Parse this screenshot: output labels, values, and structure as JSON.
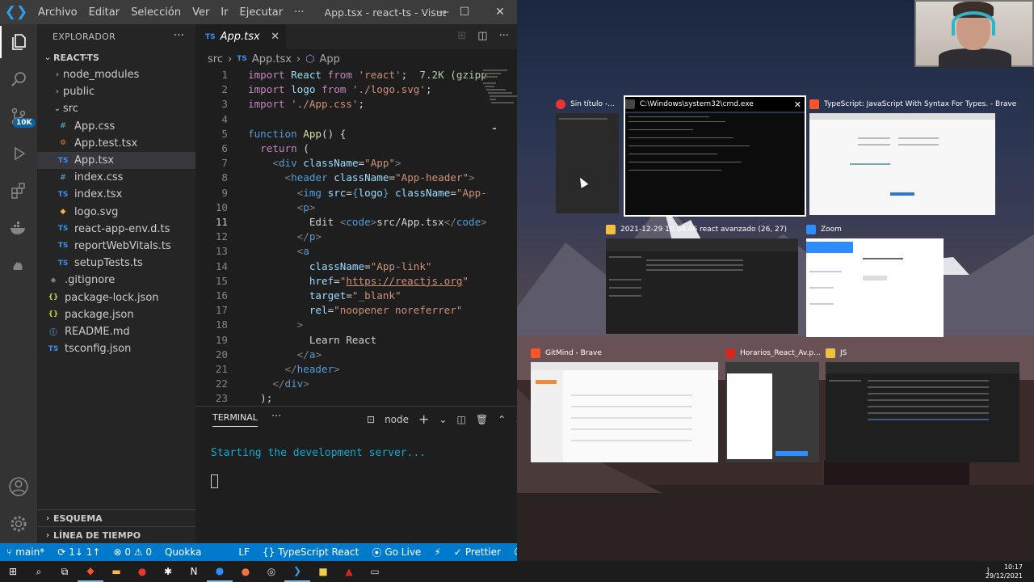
{
  "titlebar": {
    "menu": [
      "Archivo",
      "Editar",
      "Selección",
      "Ver",
      "Ir",
      "Ejecutar",
      "···"
    ],
    "title": "App.tsx - react-ts - Visual S..."
  },
  "activity": {
    "badge": "10K"
  },
  "sidebar": {
    "title": "EXPLORADOR",
    "root": "REACT-TS",
    "tree": [
      {
        "label": "node_modules",
        "kind": "folder",
        "icon": "chevron-right"
      },
      {
        "label": "public",
        "kind": "folder",
        "icon": "chevron-right"
      },
      {
        "label": "src",
        "kind": "folder-open",
        "icon": "chevron-down"
      },
      {
        "label": "App.css",
        "kind": "file",
        "icon": "#",
        "cls": "css"
      },
      {
        "label": "App.test.tsx",
        "kind": "file",
        "icon": "⚙",
        "cls": "test"
      },
      {
        "label": "App.tsx",
        "kind": "file",
        "icon": "TS",
        "cls": "ts",
        "selected": true
      },
      {
        "label": "index.css",
        "kind": "file",
        "icon": "#",
        "cls": "css"
      },
      {
        "label": "index.tsx",
        "kind": "file",
        "icon": "TS",
        "cls": "ts"
      },
      {
        "label": "logo.svg",
        "kind": "file",
        "icon": "◆",
        "cls": "svg"
      },
      {
        "label": "react-app-env.d.ts",
        "kind": "file",
        "icon": "TS",
        "cls": "ts"
      },
      {
        "label": "reportWebVitals.ts",
        "kind": "file",
        "icon": "TS",
        "cls": "ts"
      },
      {
        "label": "setupTests.ts",
        "kind": "file",
        "icon": "TS",
        "cls": "ts"
      },
      {
        "label": ".gitignore",
        "kind": "rootfile",
        "icon": "◆",
        "cls": "gray"
      },
      {
        "label": "package-lock.json",
        "kind": "rootfile",
        "icon": "{}",
        "cls": "json"
      },
      {
        "label": "package.json",
        "kind": "rootfile",
        "icon": "{}",
        "cls": "json"
      },
      {
        "label": "README.md",
        "kind": "rootfile",
        "icon": "ⓘ",
        "cls": "md"
      },
      {
        "label": "tsconfig.json",
        "kind": "rootfile",
        "icon": "TS",
        "cls": "ts"
      }
    ],
    "outline": "ESQUEMA",
    "timeline": "LÍNEA DE TIEMPO"
  },
  "tab": {
    "icon": "TS",
    "label": "App.tsx"
  },
  "breadcrumb": [
    "src",
    "›",
    "TS",
    "App.tsx",
    "›",
    "App"
  ],
  "code": [
    {
      "n": "1",
      "html": "<span class='k'>import</span> <span class='a'>React</span> <span class='k'>from</span> <span class='s'>'react'</span>;  <span class='g'>7.2K (gzipp</span>"
    },
    {
      "n": "2",
      "html": "<span class='k'>import</span> <span class='a'>logo</span> <span class='k'>from</span> <span class='s'>'./logo.svg'</span>;"
    },
    {
      "n": "3",
      "html": "<span class='k'>import</span> <span class='s'>'./App.css'</span>;"
    },
    {
      "n": "4",
      "html": ""
    },
    {
      "n": "5",
      "html": "<span class='kb'>function</span> <span class='f'>App</span>() {"
    },
    {
      "n": "6",
      "html": "  <span class='k'>return</span> ("
    },
    {
      "n": "7",
      "html": "    <span class='p'>&lt;</span><span class='tag'>div</span> <span class='a'>className</span>=<span class='s'>\"App\"</span><span class='p'>&gt;</span>"
    },
    {
      "n": "8",
      "html": "      <span class='p'>&lt;</span><span class='tag'>header</span> <span class='a'>className</span>=<span class='s'>\"App-header\"</span><span class='p'>&gt;</span>"
    },
    {
      "n": "9",
      "html": "        <span class='p'>&lt;</span><span class='tag'>img</span> <span class='a'>src</span>=<span class='kb'>{</span><span class='a'>logo</span><span class='kb'>}</span> <span class='a'>className</span>=<span class='s'>\"App-</span>"
    },
    {
      "n": "10",
      "html": "        <span class='p'>&lt;</span><span class='tag'>p</span><span class='p'>&gt;</span>"
    },
    {
      "n": "11",
      "html": "          Edit <span class='p'>&lt;</span><span class='tag'>code</span><span class='p'>&gt;</span>src/App.tsx<span class='p'>&lt;/</span><span class='tag'>code</span><span class='p'>&gt;</span>",
      "cur": true
    },
    {
      "n": "12",
      "html": "        <span class='p'>&lt;/</span><span class='tag'>p</span><span class='p'>&gt;</span>"
    },
    {
      "n": "13",
      "html": "        <span class='p'>&lt;</span><span class='tag'>a</span>"
    },
    {
      "n": "14",
      "html": "          <span class='a'>className</span>=<span class='s'>\"App-link\"</span>"
    },
    {
      "n": "15",
      "html": "          <span class='a'>href</span>=<span class='s'>\"<u>https://reactjs.org</u>\"</span>"
    },
    {
      "n": "16",
      "html": "          <span class='a'>target</span>=<span class='s'>\"_blank\"</span>"
    },
    {
      "n": "17",
      "html": "          <span class='a'>rel</span>=<span class='s'>\"noopener noreferrer\"</span>"
    },
    {
      "n": "18",
      "html": "        <span class='p'>&gt;</span>"
    },
    {
      "n": "19",
      "html": "          Learn React"
    },
    {
      "n": "20",
      "html": "        <span class='p'>&lt;/</span><span class='tag'>a</span><span class='p'>&gt;</span>"
    },
    {
      "n": "21",
      "html": "      <span class='p'>&lt;/</span><span class='tag'>header</span><span class='p'>&gt;</span>"
    },
    {
      "n": "22",
      "html": "    <span class='p'>&lt;/</span><span class='tag'>div</span><span class='p'>&gt;</span>"
    },
    {
      "n": "23",
      "html": "  );"
    }
  ],
  "terminal": {
    "title": "TERMINAL",
    "dots": "···",
    "shell": "node",
    "output": "Starting the development server..."
  },
  "statusbar": {
    "branch": "main*",
    "sync": "1↓ 1↑",
    "problems": "⊗ 0 ⚠ 0",
    "quokka": "Quokka",
    "eol": "LF",
    "language": "TypeScript React",
    "golive": "Go Live",
    "prettier": "Prettier"
  },
  "windows": [
    {
      "label": "Sin título -...",
      "theme": "dark"
    },
    {
      "label": "C:\\Windows\\system32\\cmd.exe",
      "theme": "cmd"
    },
    {
      "label": "TypeScript: JavaScript With Syntax For Types. - Brave",
      "theme": "light"
    },
    {
      "label": "2021-12-29 10.04.46 react avanzado (26, 27)",
      "theme": "dark"
    },
    {
      "label": "Zoom",
      "theme": "light"
    },
    {
      "label": "GitMind - Brave",
      "theme": "light"
    },
    {
      "label": "Horarios_React_Av.p...",
      "theme": "light"
    },
    {
      "label": "JS",
      "theme": "dark"
    }
  ],
  "clock": {
    "time": "10:17",
    "date": "29/12/2021"
  }
}
